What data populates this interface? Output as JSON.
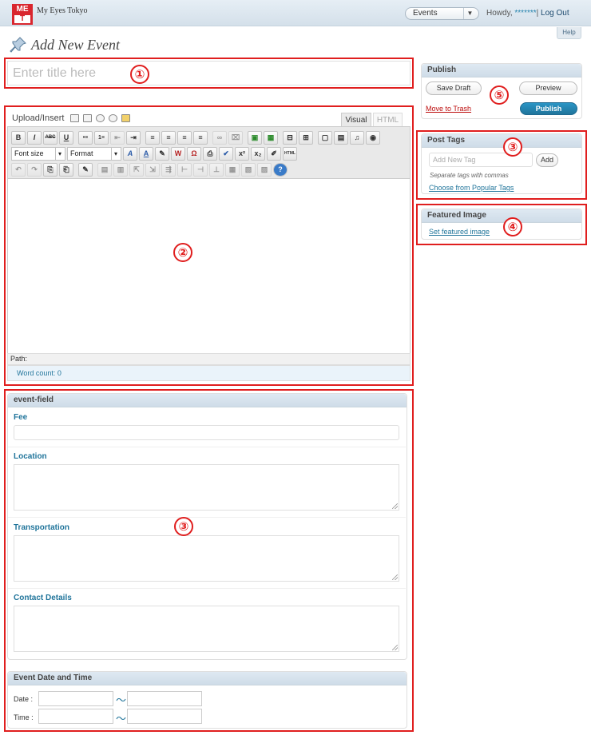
{
  "header": {
    "site_name": "My Eyes Tokyo",
    "logo_text_top": "ME",
    "logo_text_bottom": "T",
    "favorites_selected": "Events",
    "howdy_prefix": "Howdy,",
    "username": "*******",
    "separator": "|",
    "logout": "Log Out",
    "help": "Help"
  },
  "page": {
    "title": "Add New Event",
    "title_icon": "pushpin-icon"
  },
  "title_field": {
    "placeholder": "Enter title here"
  },
  "editor": {
    "upload_insert": "Upload/Insert",
    "media_icons": [
      "image-icon",
      "video-icon",
      "audio-icon",
      "media-icon",
      "gallery-icon"
    ],
    "tab_visual": "Visual",
    "tab_html": "HTML",
    "row1": [
      "B",
      "I",
      "ABC",
      "U",
      "•≡",
      "1≡",
      "⇤",
      "⇥",
      "≡",
      "≡",
      "≡",
      "≡",
      "∞",
      "⌧",
      "▣",
      "▦",
      "⊟",
      "⊞",
      "▢",
      "▤",
      "♫",
      "◉"
    ],
    "font_size": "Font size",
    "format": "Format",
    "row2": [
      "A",
      "A",
      "✎",
      "W",
      "Ω",
      "⎙",
      "✔",
      "x²",
      "x₂",
      "✐",
      "HTML"
    ],
    "row3": [
      "↶",
      "↷",
      "⎘",
      "⎗",
      "✎",
      "▤",
      "▥",
      "⇱",
      "⇲",
      "⇶",
      "⊢",
      "⊣",
      "⊥",
      "▦",
      "▧",
      "▨",
      "?"
    ],
    "path_label": "Path:",
    "word_count": "Word count: 0"
  },
  "event_field": {
    "title": "event-field",
    "fee_label": "Fee",
    "location_label": "Location",
    "transportation_label": "Transportation",
    "contact_label": "Contact Details"
  },
  "event_datetime": {
    "title": "Event Date and Time",
    "date_label": "Date :",
    "time_label": "Time :",
    "range_sep": "～"
  },
  "publish": {
    "title": "Publish",
    "save_draft": "Save Draft",
    "preview": "Preview",
    "trash": "Move to Trash",
    "publish_button": "Publish"
  },
  "post_tags": {
    "title": "Post Tags",
    "placeholder": "Add New Tag",
    "add": "Add",
    "hint": "Separate tags with commas",
    "popular": "Choose from Popular Tags"
  },
  "featured_image": {
    "title": "Featured Image",
    "set_link": "Set featured image"
  },
  "annotations": {
    "n1": "①",
    "n2": "②",
    "n3a": "③",
    "n3b": "③",
    "n4": "④",
    "n5": "⑤",
    "color": "#e01e1e"
  }
}
